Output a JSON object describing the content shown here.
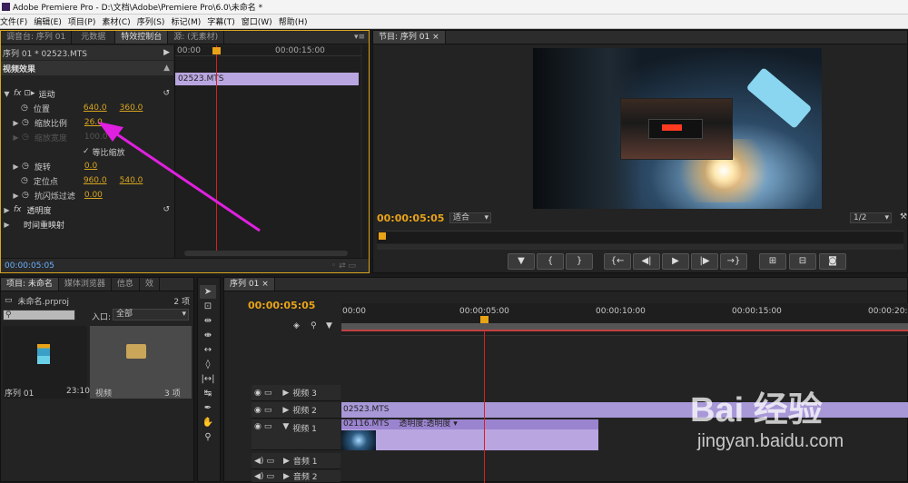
{
  "title": "Adobe Premiere Pro - D:\\文档\\Adobe\\Premiere Pro\\6.0\\未命名 *",
  "menu": [
    "文件(F)",
    "编辑(E)",
    "项目(P)",
    "素材(C)",
    "序列(S)",
    "标记(M)",
    "字幕(T)",
    "窗口(W)",
    "帮助(H)"
  ],
  "effects_panel": {
    "tabs": [
      "调音台: 序列 01",
      "元数据",
      "特效控制台",
      "源: (无素材)"
    ],
    "clip_header": "序列 01 * 02523.MTS",
    "ruler_start": "00:00",
    "ruler_mid": "00:00:15:00",
    "section": "视频效果",
    "clip_name": "02523.MTS",
    "motion": "运动",
    "position_label": "位置",
    "position_x": "640.0",
    "position_y": "360.0",
    "scale_label": "缩放比例",
    "scale_value": "26.0",
    "scale_width_label": "缩放宽度",
    "scale_width_value": "100.0",
    "uniform_scale_label": "等比缩放",
    "rotation_label": "旋转",
    "rotation_value": "0.0",
    "anchor_label": "定位点",
    "anchor_x": "960.0",
    "anchor_y": "540.0",
    "flicker_label": "抗闪烁过滤",
    "flicker_value": "0.00",
    "opacity_label": "透明度",
    "time_remap_label": "时间重映射",
    "timecode": "00:00:05:05"
  },
  "program_monitor": {
    "tab": "节目: 序列 01",
    "timecode": "00:00:05:05",
    "fit": "适合",
    "resolution": "1/2"
  },
  "project_panel": {
    "tabs": [
      "项目: 未命名",
      "媒体浏览器",
      "信息",
      "效"
    ],
    "file": "未命名.prproj",
    "count": "2 项",
    "entry_label": "入口:",
    "entry_value": "全部",
    "items": [
      {
        "name": "序列 01",
        "meta": "23:10"
      },
      {
        "name": "视频",
        "meta": "3 项"
      }
    ]
  },
  "timeline": {
    "tab": "序列 01",
    "timecode": "00:00:05:05",
    "ruler": [
      "00:00",
      "00:00:05:00",
      "00:00:10:00",
      "00:00:15:00",
      "00:00:20:00"
    ],
    "tracks": [
      "视频 3",
      "视频 2",
      "视频 1",
      "音频 1",
      "音频 2"
    ],
    "clip_v2": "02523.MTS",
    "clip_v1": "02116.MTS",
    "clip_v1_fx": "透明度:透明度 ▾"
  },
  "watermark": {
    "text": "Bai 经验",
    "url": "jingyan.baidu.com"
  },
  "colors": {
    "accent": "#e8a317",
    "clip": "#b9a6e0",
    "arrow": "#e020e0",
    "playhead": "#d62020"
  }
}
